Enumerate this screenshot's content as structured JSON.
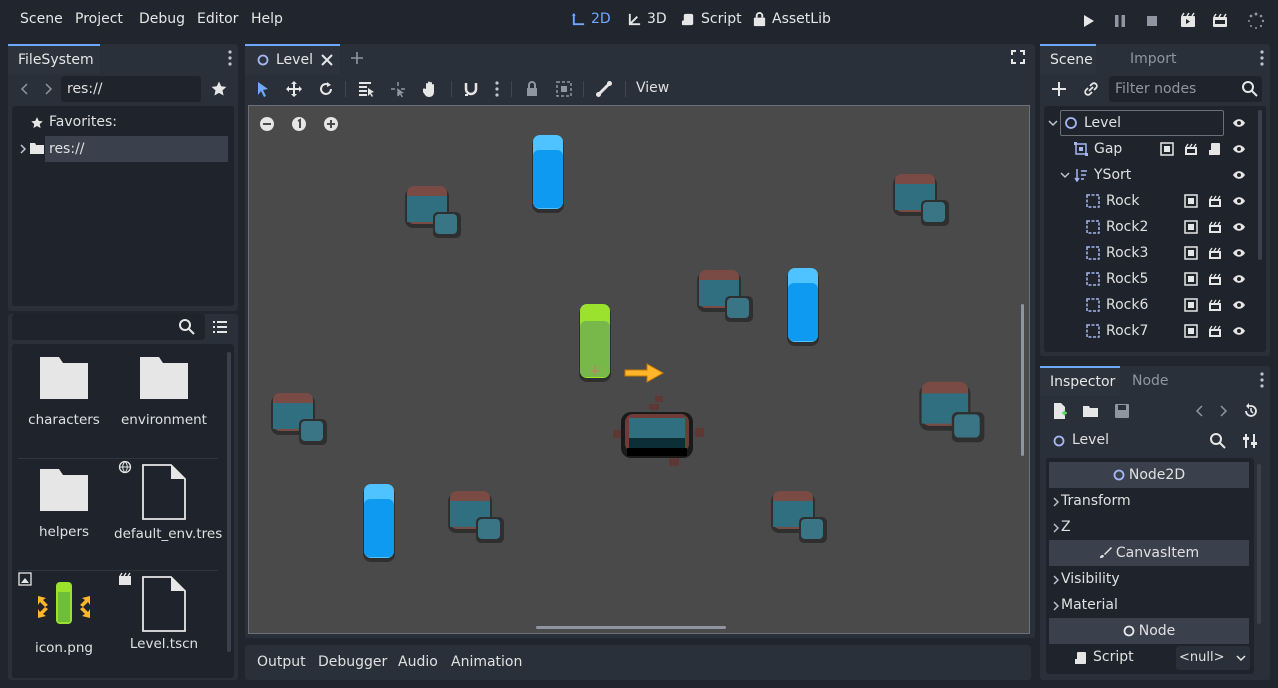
{
  "menu": {
    "scene": "Scene",
    "project": "Project",
    "debug": "Debug",
    "editor": "Editor",
    "help": "Help"
  },
  "workspaces": {
    "w2d": "2D",
    "w3d": "3D",
    "script": "Script",
    "assetlib": "AssetLib"
  },
  "filesystem": {
    "tab": "FileSystem",
    "path": "res://",
    "favorites": "Favorites:",
    "root": "res://",
    "filter_placeholder": "",
    "items": [
      {
        "name": "characters"
      },
      {
        "name": "environment"
      },
      {
        "name": "helpers"
      },
      {
        "name": "default_env.tres"
      },
      {
        "name": "icon.png"
      },
      {
        "name": "Level.tscn"
      }
    ]
  },
  "editor": {
    "scene_tab": "Level",
    "view_menu": "View",
    "bottom_tabs": {
      "output": "Output",
      "debugger": "Debugger",
      "audio": "Audio",
      "animation": "Animation"
    }
  },
  "scene_dock": {
    "tab_scene": "Scene",
    "tab_import": "Import",
    "filter_placeholder": "Filter nodes",
    "nodes": [
      {
        "name": "Level"
      },
      {
        "name": "Gap"
      },
      {
        "name": "YSort"
      },
      {
        "name": "Rock"
      },
      {
        "name": "Rock2"
      },
      {
        "name": "Rock3"
      },
      {
        "name": "Rock5"
      },
      {
        "name": "Rock6"
      },
      {
        "name": "Rock7"
      }
    ]
  },
  "inspector": {
    "tab_inspector": "Inspector",
    "tab_node": "Node",
    "object": "Level",
    "sections": {
      "node2d": "Node2D",
      "canvasitem": "CanvasItem",
      "node": "Node"
    },
    "props": {
      "transform": "Transform",
      "z": "Z",
      "visibility": "Visibility",
      "material": "Material",
      "script": "Script",
      "script_value": "<null>"
    }
  },
  "colors": {
    "accent": "#6fa9ff",
    "bg": "#20252e",
    "panel": "#2a3039",
    "viewport": "#4a4a4a"
  }
}
